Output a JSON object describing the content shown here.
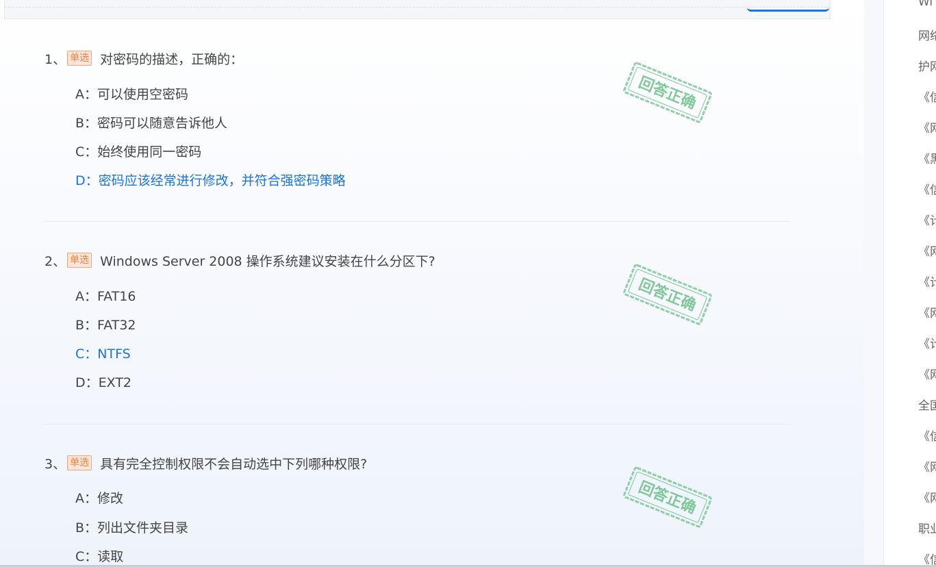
{
  "questions": [
    {
      "num": "1、",
      "tag": "单选",
      "text": "对密码的描述，正确的：",
      "stamp": "回答正确",
      "options": [
        {
          "label": "A：可以使用空密码",
          "correct": false
        },
        {
          "label": "B：密码可以随意告诉他人",
          "correct": false
        },
        {
          "label": "C：始终使用同一密码",
          "correct": false
        },
        {
          "label": "D：密码应该经常进行修改，并符合强密码策略",
          "correct": true
        }
      ]
    },
    {
      "num": "2、",
      "tag": "单选",
      "text": "Windows Server 2008 操作系统建议安装在什么分区下?",
      "stamp": "回答正确",
      "options": [
        {
          "label": "A：FAT16",
          "correct": false
        },
        {
          "label": "B：FAT32",
          "correct": false
        },
        {
          "label": "C：NTFS",
          "correct": true
        },
        {
          "label": "D：EXT2",
          "correct": false
        }
      ]
    },
    {
      "num": "3、",
      "tag": "单选",
      "text": "具有完全控制权限不会自动选中下列哪种权限?",
      "stamp": "回答正确",
      "options": [
        {
          "label": "A：修改",
          "correct": false
        },
        {
          "label": "B：列出文件夹目录",
          "correct": false
        },
        {
          "label": "C：读取",
          "correct": false
        }
      ]
    }
  ],
  "sidebar": {
    "items": [
      "Wi",
      "网络",
      "护网",
      "《信",
      "《网",
      "《黑",
      "《信",
      "《计",
      "《网",
      "《计",
      "《网",
      "《计",
      "《网",
      "全国",
      "《信",
      "《网",
      "《网",
      "职业",
      "《信"
    ]
  },
  "colors": {
    "correct": "#1a73e8",
    "tag": "#f07d3c",
    "stamp": "#6cc08a"
  }
}
